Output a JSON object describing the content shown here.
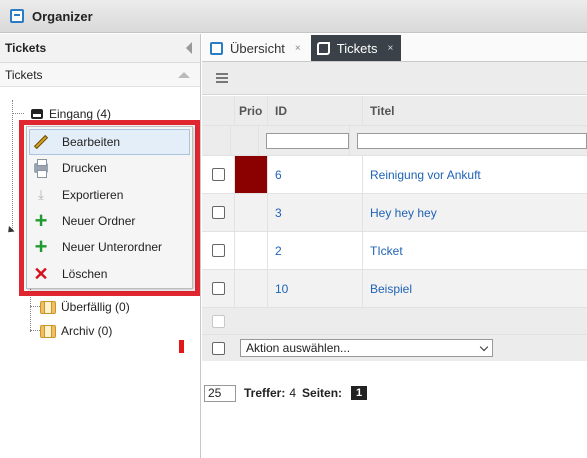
{
  "app": {
    "title": "Organizer",
    "icon": "organizer-app-icon"
  },
  "left_panel": {
    "header": "Tickets",
    "subheader": "Tickets",
    "tree": [
      {
        "label": "Eingang (4)",
        "icon": "inbox-icon"
      },
      {
        "label": "Überfällig (0)",
        "icon": "folder-icon"
      },
      {
        "label": "Archiv (0)",
        "icon": "folder-icon"
      }
    ]
  },
  "context_menu": {
    "items": [
      {
        "label": "Bearbeiten",
        "icon": "pencil-icon"
      },
      {
        "label": "Drucken",
        "icon": "printer-icon"
      },
      {
        "label": "Exportieren",
        "icon": "export-icon"
      },
      {
        "label": "Neuer Ordner",
        "icon": "plus-icon"
      },
      {
        "label": "Neuer Unterordner",
        "icon": "plus-icon"
      },
      {
        "label": "Löschen",
        "icon": "delete-icon"
      }
    ],
    "highlight_color": "#e0262e"
  },
  "tabs": [
    {
      "label": "Übersicht",
      "close": "×",
      "active": false
    },
    {
      "label": "Tickets",
      "close": "×",
      "active": true
    }
  ],
  "grid": {
    "columns": {
      "prio": "Prio",
      "id": "ID",
      "title": "Titel"
    },
    "rows": [
      {
        "id": "6",
        "title": "Reinigung vor Ankuft",
        "prio_color": "#8b0000"
      },
      {
        "id": "3",
        "title": "Hey hey hey",
        "prio_color": ""
      },
      {
        "id": "2",
        "title": "TIcket",
        "prio_color": ""
      },
      {
        "id": "10",
        "title": "Beispiel",
        "prio_color": ""
      }
    ],
    "action_select": "Aktion auswählen..."
  },
  "pager": {
    "page_size": "25",
    "hits_label": "Treffer:",
    "hits_value": "4",
    "pages_label": "Seiten:",
    "current_page": "1"
  }
}
